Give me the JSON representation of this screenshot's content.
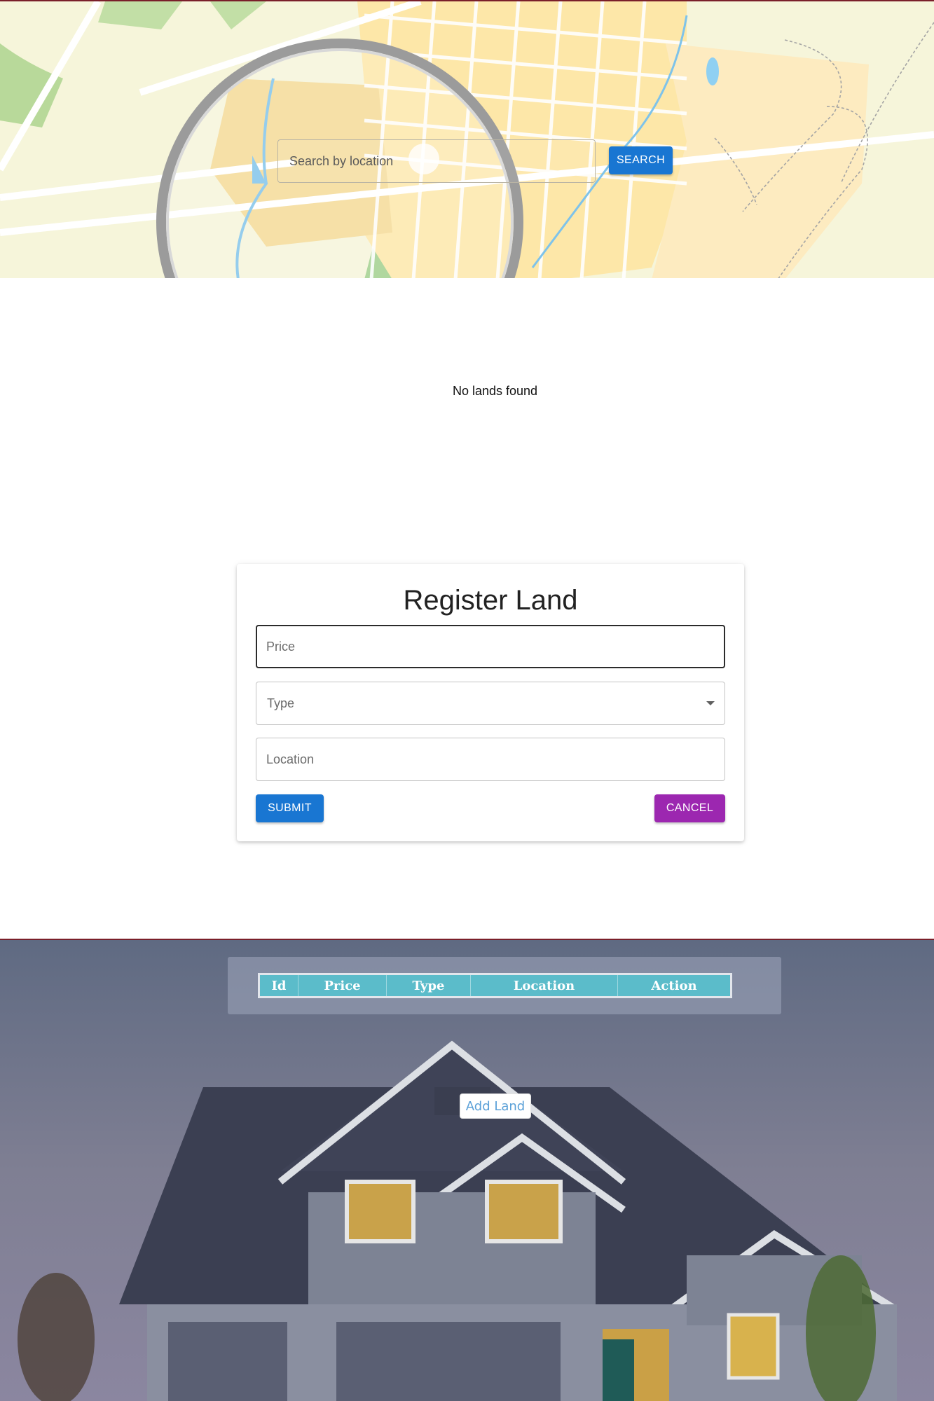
{
  "search": {
    "placeholder": "Search by location",
    "button_label": "SEARCH"
  },
  "results": {
    "empty_message": "No lands found"
  },
  "register_form": {
    "title": "Register Land",
    "price_placeholder": "Price",
    "type_label": "Type",
    "location_placeholder": "Location",
    "submit_label": "SUBMIT",
    "cancel_label": "CANCEL"
  },
  "land_table": {
    "columns": [
      "Id",
      "Price",
      "Type",
      "Location",
      "Action"
    ]
  },
  "add_land": {
    "label": "Add Land"
  },
  "colors": {
    "primary": "#1976d2",
    "secondary": "#9c27b0",
    "table_header": "#5bbcca",
    "accent_border": "#7a1f2a"
  }
}
